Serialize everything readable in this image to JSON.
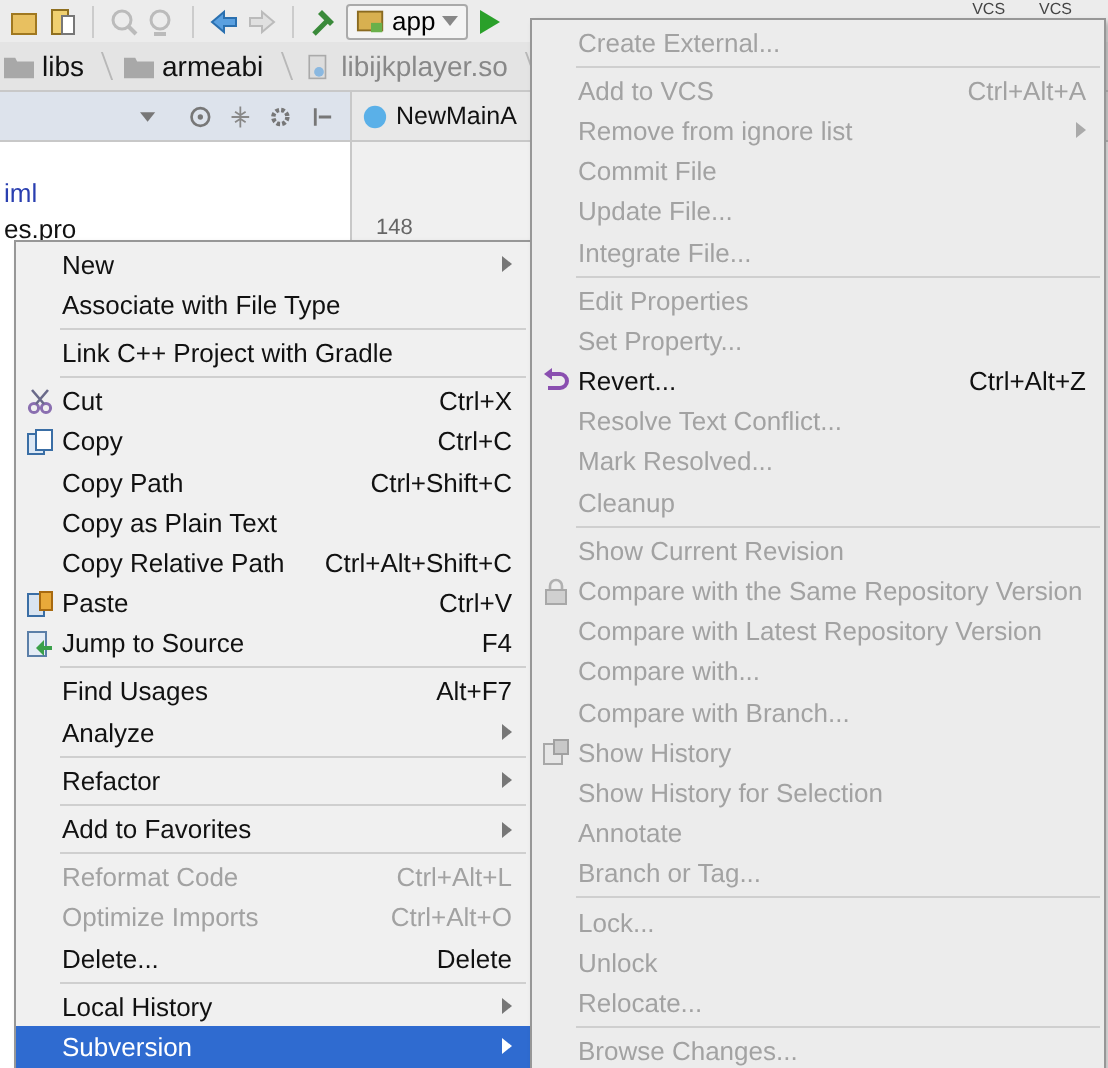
{
  "toolbar": {
    "run_config": "app",
    "vcs_labels": [
      "VCS",
      "VCS"
    ]
  },
  "breadcrumbs": [
    {
      "label": "libs",
      "kind": "folder"
    },
    {
      "label": "armeabi",
      "kind": "folder"
    },
    {
      "label": "libijkplayer.so",
      "kind": "file"
    }
  ],
  "project_tree": [
    {
      "label": "iml",
      "kind": "module"
    },
    {
      "label": "es.pro",
      "kind": "file"
    }
  ],
  "editor": {
    "tab": "NewMainA",
    "line_number": "148"
  },
  "context_menu": [
    {
      "kind": "item",
      "label": "New",
      "submenu": true,
      "disabled": false,
      "selected": false
    },
    {
      "kind": "item",
      "label": "Associate with File Type",
      "submenu": false,
      "disabled": false,
      "selected": false
    },
    {
      "kind": "separator"
    },
    {
      "kind": "item",
      "label": "Link C++ Project with Gradle",
      "submenu": false,
      "disabled": false,
      "selected": false
    },
    {
      "kind": "separator"
    },
    {
      "kind": "item",
      "label": "Cut",
      "shortcut": "Ctrl+X",
      "submenu": false,
      "disabled": false,
      "selected": false
    },
    {
      "kind": "item",
      "label": "Copy",
      "shortcut": "Ctrl+C",
      "submenu": false,
      "disabled": false,
      "selected": false
    },
    {
      "kind": "item",
      "label": "Copy Path",
      "shortcut": "Ctrl+Shift+C",
      "submenu": false,
      "disabled": false,
      "selected": false
    },
    {
      "kind": "item",
      "label": "Copy as Plain Text",
      "submenu": false,
      "disabled": false,
      "selected": false
    },
    {
      "kind": "item",
      "label": "Copy Relative Path",
      "shortcut": "Ctrl+Alt+Shift+C",
      "submenu": false,
      "disabled": false,
      "selected": false
    },
    {
      "kind": "item",
      "label": "Paste",
      "shortcut": "Ctrl+V",
      "submenu": false,
      "disabled": false,
      "selected": false
    },
    {
      "kind": "item",
      "label": "Jump to Source",
      "shortcut": "F4",
      "submenu": false,
      "disabled": false,
      "selected": false
    },
    {
      "kind": "separator"
    },
    {
      "kind": "item",
      "label": "Find Usages",
      "shortcut": "Alt+F7",
      "submenu": false,
      "disabled": false,
      "selected": false
    },
    {
      "kind": "item",
      "label": "Analyze",
      "submenu": true,
      "disabled": false,
      "selected": false
    },
    {
      "kind": "separator"
    },
    {
      "kind": "item",
      "label": "Refactor",
      "submenu": true,
      "disabled": false,
      "selected": false
    },
    {
      "kind": "separator"
    },
    {
      "kind": "item",
      "label": "Add to Favorites",
      "submenu": true,
      "disabled": false,
      "selected": false
    },
    {
      "kind": "separator"
    },
    {
      "kind": "item",
      "label": "Reformat Code",
      "shortcut": "Ctrl+Alt+L",
      "submenu": false,
      "disabled": true,
      "selected": false
    },
    {
      "kind": "item",
      "label": "Optimize Imports",
      "shortcut": "Ctrl+Alt+O",
      "submenu": false,
      "disabled": true,
      "selected": false
    },
    {
      "kind": "item",
      "label": "Delete...",
      "shortcut": "Delete",
      "submenu": false,
      "disabled": false,
      "selected": false
    },
    {
      "kind": "separator"
    },
    {
      "kind": "item",
      "label": "Local History",
      "submenu": true,
      "disabled": false,
      "selected": false
    },
    {
      "kind": "item",
      "label": "Subversion",
      "submenu": true,
      "disabled": false,
      "selected": true
    }
  ],
  "submenu": [
    {
      "kind": "item",
      "label": "Create External...",
      "submenu": false,
      "disabled": true,
      "selected": false
    },
    {
      "kind": "separator"
    },
    {
      "kind": "item",
      "label": "Add to VCS",
      "shortcut": "Ctrl+Alt+A",
      "submenu": false,
      "disabled": true,
      "selected": false
    },
    {
      "kind": "item",
      "label": "Remove from ignore list",
      "submenu": true,
      "disabled": true,
      "selected": false
    },
    {
      "kind": "item",
      "label": "Commit File",
      "submenu": false,
      "disabled": true,
      "selected": false
    },
    {
      "kind": "item",
      "label": "Update File...",
      "submenu": false,
      "disabled": true,
      "selected": false
    },
    {
      "kind": "item",
      "label": "Integrate File...",
      "submenu": false,
      "disabled": true,
      "selected": false
    },
    {
      "kind": "separator"
    },
    {
      "kind": "item",
      "label": "Edit Properties",
      "submenu": false,
      "disabled": true,
      "selected": false
    },
    {
      "kind": "item",
      "label": "Set Property...",
      "submenu": false,
      "disabled": true,
      "selected": false
    },
    {
      "kind": "item",
      "label": "Revert...",
      "shortcut": "Ctrl+Alt+Z",
      "submenu": false,
      "disabled": false,
      "selected": false
    },
    {
      "kind": "item",
      "label": "Resolve Text Conflict...",
      "submenu": false,
      "disabled": true,
      "selected": false
    },
    {
      "kind": "item",
      "label": "Mark Resolved...",
      "submenu": false,
      "disabled": true,
      "selected": false
    },
    {
      "kind": "item",
      "label": "Cleanup",
      "submenu": false,
      "disabled": true,
      "selected": false
    },
    {
      "kind": "separator"
    },
    {
      "kind": "item",
      "label": "Show Current Revision",
      "submenu": false,
      "disabled": true,
      "selected": false
    },
    {
      "kind": "item",
      "label": "Compare with the Same Repository Version",
      "submenu": false,
      "disabled": true,
      "selected": false
    },
    {
      "kind": "item",
      "label": "Compare with Latest Repository Version",
      "submenu": false,
      "disabled": true,
      "selected": false
    },
    {
      "kind": "item",
      "label": "Compare with...",
      "submenu": false,
      "disabled": true,
      "selected": false
    },
    {
      "kind": "item",
      "label": "Compare with Branch...",
      "submenu": false,
      "disabled": true,
      "selected": false
    },
    {
      "kind": "item",
      "label": "Show History",
      "submenu": false,
      "disabled": true,
      "selected": false
    },
    {
      "kind": "item",
      "label": "Show History for Selection",
      "submenu": false,
      "disabled": true,
      "selected": false
    },
    {
      "kind": "item",
      "label": "Annotate",
      "submenu": false,
      "disabled": true,
      "selected": false
    },
    {
      "kind": "item",
      "label": "Branch or Tag...",
      "submenu": false,
      "disabled": true,
      "selected": false
    },
    {
      "kind": "separator"
    },
    {
      "kind": "item",
      "label": "Lock...",
      "submenu": false,
      "disabled": true,
      "selected": false
    },
    {
      "kind": "item",
      "label": "Unlock",
      "submenu": false,
      "disabled": true,
      "selected": false
    },
    {
      "kind": "item",
      "label": "Relocate...",
      "submenu": false,
      "disabled": true,
      "selected": false
    },
    {
      "kind": "separator"
    },
    {
      "kind": "item",
      "label": "Browse Changes...",
      "submenu": false,
      "disabled": true,
      "selected": false
    }
  ]
}
